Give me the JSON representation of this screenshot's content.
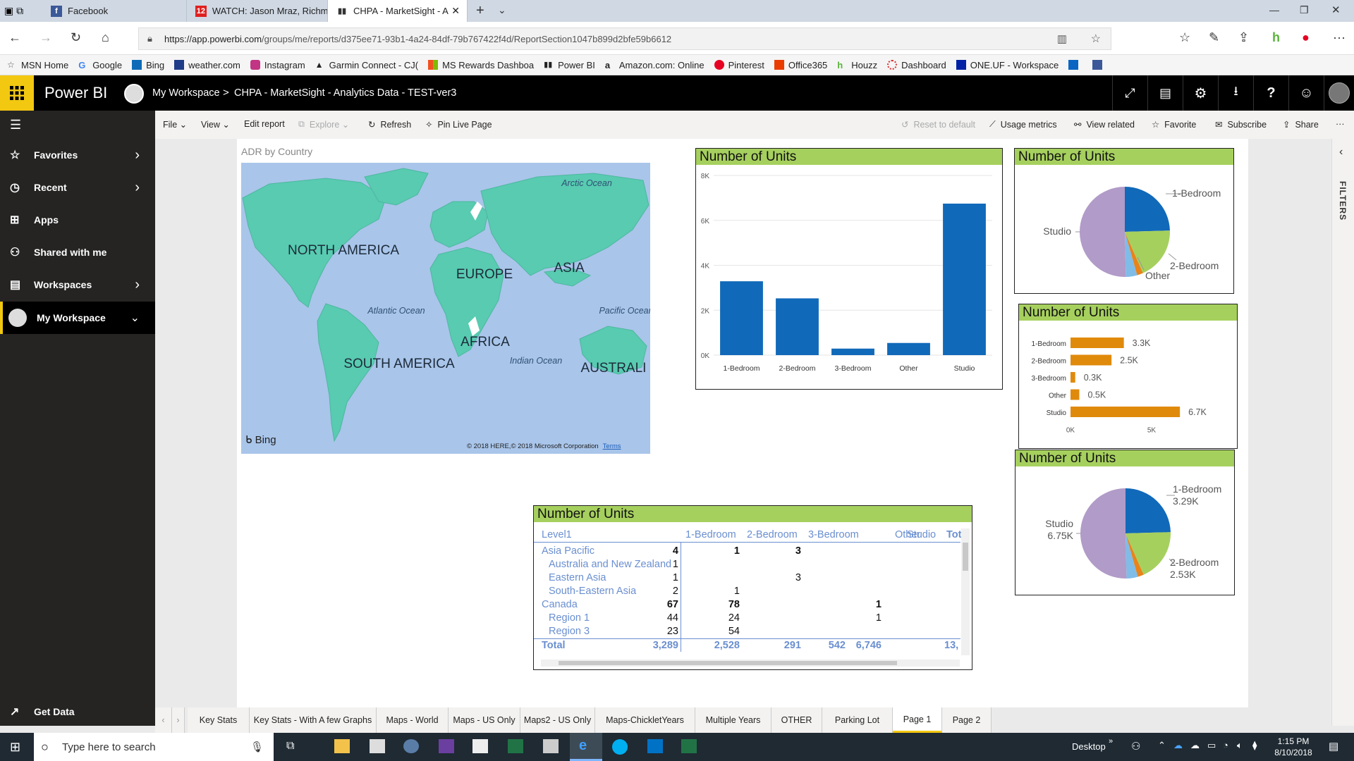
{
  "browser": {
    "tabs": [
      {
        "label": "Facebook",
        "icon": "facebook-icon",
        "color": "#3b5998"
      },
      {
        "label": "WATCH: Jason Mraz, Richmo",
        "icon": "news-12-icon",
        "color": "#e02020"
      },
      {
        "label": "CHPA - MarketSight - A",
        "icon": "powerbi-icon",
        "color": "#333333"
      }
    ],
    "url_host": "https://app.powerbi.com",
    "url_path": "/groups/me/reports/d375ee71-93b1-4a24-84df-79b767422f4d/ReportSection1047b899d2bfe59b6612",
    "favorites": [
      "MSN Home",
      "Google",
      "Bing",
      "weather.com",
      "Instagram",
      "Garmin Connect - CJ(",
      "MS Rewards Dashboa",
      "Power BI",
      "Amazon.com: Online",
      "Pinterest",
      "Office365",
      "Houzz",
      "Dashboard",
      "ONE.UF - Workspace"
    ]
  },
  "header": {
    "app": "Power BI",
    "workspace": "My Workspace",
    "sep": ">",
    "report": "CHPA - MarketSight - Analytics Data - TEST-ver3"
  },
  "commands": {
    "file": "File",
    "view": "View",
    "edit": "Edit report",
    "explore": "Explore",
    "refresh": "Refresh",
    "pin": "Pin Live Page",
    "reset": "Reset to default",
    "usage": "Usage metrics",
    "related": "View related",
    "favorite": "Favorite",
    "subscribe": "Subscribe",
    "share": "Share",
    "more": "···"
  },
  "sidebar": {
    "items": [
      {
        "label": "Favorites"
      },
      {
        "label": "Recent"
      },
      {
        "label": "Apps"
      },
      {
        "label": "Shared with me"
      },
      {
        "label": "Workspaces"
      },
      {
        "label": "My Workspace"
      }
    ],
    "get_data": "Get Data"
  },
  "filters_label": "FILTERS",
  "map": {
    "title": "ADR by Country",
    "labels": [
      "NORTH AMERICA",
      "SOUTH AMERICA",
      "EUROPE",
      "AFRICA",
      "ASIA",
      "AUSTRALI",
      "Arctic Ocean",
      "Atlantic Ocean",
      "Pacific Ocean",
      "Indian Ocean"
    ],
    "bing": "Bing",
    "copyright": "© 2018 HERE,© 2018 Microsoft Corporation",
    "terms": "Terms"
  },
  "chart_data": [
    {
      "type": "bar",
      "title": "Number of Units",
      "categories": [
        "1-Bedroom",
        "2-Bedroom",
        "3-Bedroom",
        "Other",
        "Studio"
      ],
      "values": [
        3289,
        2528,
        291,
        542,
        6746
      ],
      "ylim": [
        0,
        8000
      ],
      "yticks": [
        "0K",
        "2K",
        "4K",
        "6K",
        "8K"
      ],
      "color": "#1169b9"
    },
    {
      "type": "pie",
      "title": "Number of Units",
      "labels": [
        "1-Bedroom",
        "2-Bedroom",
        "Other",
        "Studio"
      ],
      "values": [
        3289,
        2528,
        833,
        6746
      ],
      "slices": [
        {
          "name": "1-Bedroom",
          "value": 3289,
          "color": "#1169b9"
        },
        {
          "name": "2-Bedroom",
          "value": 2528,
          "color": "#a6d05e"
        },
        {
          "name": "3-Bedroom",
          "value": 291,
          "color": "#e8841a"
        },
        {
          "name": "Other",
          "value": 542,
          "color": "#7fbce8"
        },
        {
          "name": "Studio",
          "value": 6746,
          "color": "#b19bc8"
        }
      ]
    },
    {
      "type": "bar",
      "orientation": "horizontal",
      "title": "Number of Units",
      "categories": [
        "1-Bedroom",
        "2-Bedroom",
        "3-Bedroom",
        "Other",
        "Studio"
      ],
      "values": [
        3289,
        2528,
        291,
        542,
        6746
      ],
      "value_labels": [
        "3.3K",
        "2.5K",
        "0.3K",
        "0.5K",
        "6.7K"
      ],
      "xticks": [
        "0K",
        "5K"
      ],
      "xlim": [
        0,
        10000
      ],
      "color": "#e08a0b"
    },
    {
      "type": "pie",
      "title": "Number of Units",
      "labels": [
        "1-Bedroom",
        "3.29K",
        "2-Bedroom",
        "2.53K",
        "Studio",
        "6.75K"
      ],
      "slices": [
        {
          "name": "1-Bedroom",
          "value": 3289,
          "color": "#1169b9"
        },
        {
          "name": "2-Bedroom",
          "value": 2528,
          "color": "#a6d05e"
        },
        {
          "name": "3-Bedroom",
          "value": 291,
          "color": "#e8841a"
        },
        {
          "name": "Other",
          "value": 542,
          "color": "#7fbce8"
        },
        {
          "name": "Studio",
          "value": 6746,
          "color": "#b19bc8"
        }
      ]
    }
  ],
  "matrix": {
    "title": "Number of Units",
    "headers": [
      "Level1",
      "1-Bedroom",
      "2-Bedroom",
      "3-Bedroom",
      "Other",
      "Studio",
      "Tot"
    ],
    "rows": [
      {
        "label": "Asia Pacific",
        "bold": true,
        "indent": false,
        "cells": [
          "4",
          "1",
          "3",
          "",
          ""
        ]
      },
      {
        "label": "Australia and New Zealand",
        "bold": false,
        "indent": true,
        "cells": [
          "1",
          "",
          "",
          "",
          ""
        ]
      },
      {
        "label": "Eastern Asia",
        "bold": false,
        "indent": true,
        "cells": [
          "1",
          "",
          "3",
          "",
          ""
        ]
      },
      {
        "label": "South-Eastern Asia",
        "bold": false,
        "indent": true,
        "cells": [
          "2",
          "1",
          "",
          "",
          ""
        ]
      },
      {
        "label": "Canada",
        "bold": true,
        "indent": false,
        "cells": [
          "67",
          "78",
          "",
          "",
          "1"
        ]
      },
      {
        "label": "Region 1",
        "bold": false,
        "indent": true,
        "cells": [
          "44",
          "24",
          "",
          "",
          "1"
        ]
      },
      {
        "label": "Region 3",
        "bold": false,
        "indent": true,
        "cells": [
          "23",
          "54",
          "",
          "",
          ""
        ]
      }
    ],
    "total": {
      "label": "Total",
      "cells": [
        "3,289",
        "2,528",
        "291",
        "542",
        "6,746",
        "13,"
      ]
    }
  },
  "page_tabs": [
    "Key Stats",
    "Key Stats - With A few Graphs",
    "Maps - World",
    "Maps - US Only",
    "Maps2 - US Only",
    "Maps-ChickletYears",
    "Multiple Years",
    "OTHER",
    "Parking Lot",
    "Page 1",
    "Page 2"
  ],
  "active_page": "Page 1",
  "taskbar": {
    "search": "Type here to search",
    "desktop": "Desktop",
    "time": "1:15 PM",
    "date": "8/10/2018"
  }
}
